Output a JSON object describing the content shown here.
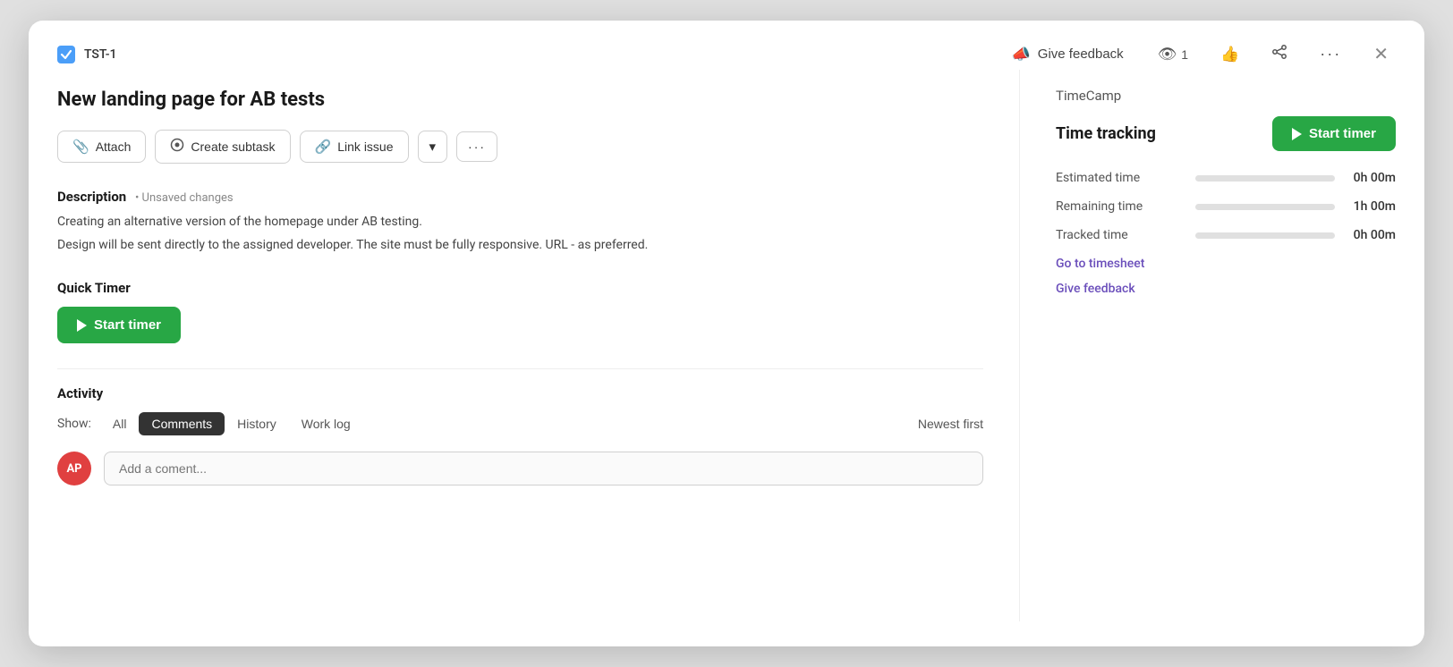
{
  "modal": {
    "issue_id": "TST-1",
    "title": "New landing page for AB tests",
    "header": {
      "give_feedback_label": "Give feedback",
      "watch_count": "1",
      "close_label": "✕"
    },
    "action_buttons": {
      "attach": "Attach",
      "create_subtask": "Create subtask",
      "link_issue": "Link issue"
    },
    "description": {
      "label": "Description",
      "unsaved": "• Unsaved changes",
      "line1": "Creating an alternative version of the homepage under AB testing.",
      "line2": "Design will be sent directly to the assigned developer. The site must be fully responsive. URL - as preferred."
    },
    "quick_timer": {
      "label": "Quick Timer",
      "start_button": "Start timer"
    },
    "activity": {
      "label": "Activity",
      "show_label": "Show:",
      "filters": [
        "All",
        "Comments",
        "History",
        "Work log"
      ],
      "active_filter": "Comments",
      "sort_label": "Newest first"
    },
    "comment": {
      "avatar_initials": "AP",
      "placeholder": "Add a coment..."
    }
  },
  "sidebar": {
    "app_name": "TimeCamp",
    "time_tracking": {
      "title": "Time tracking",
      "start_button": "Start timer",
      "rows": [
        {
          "label": "Estimated time",
          "value": "0h 00m",
          "fill": 0
        },
        {
          "label": "Remaining time",
          "value": "1h 00m",
          "fill": 0
        },
        {
          "label": "Tracked time",
          "value": "0h 00m",
          "fill": 0
        }
      ]
    },
    "links": [
      {
        "label": "Go to timesheet"
      },
      {
        "label": "Give feedback"
      }
    ]
  },
  "icons": {
    "checkbox_check": "✓",
    "attach": "📎",
    "subtask": "⊙",
    "link": "🔗",
    "chevron_down": "▾",
    "more": "···",
    "megaphone": "📣",
    "eye": "👁",
    "thumb_up": "👍",
    "share": "⬆",
    "dots": "···",
    "play": "▶"
  }
}
